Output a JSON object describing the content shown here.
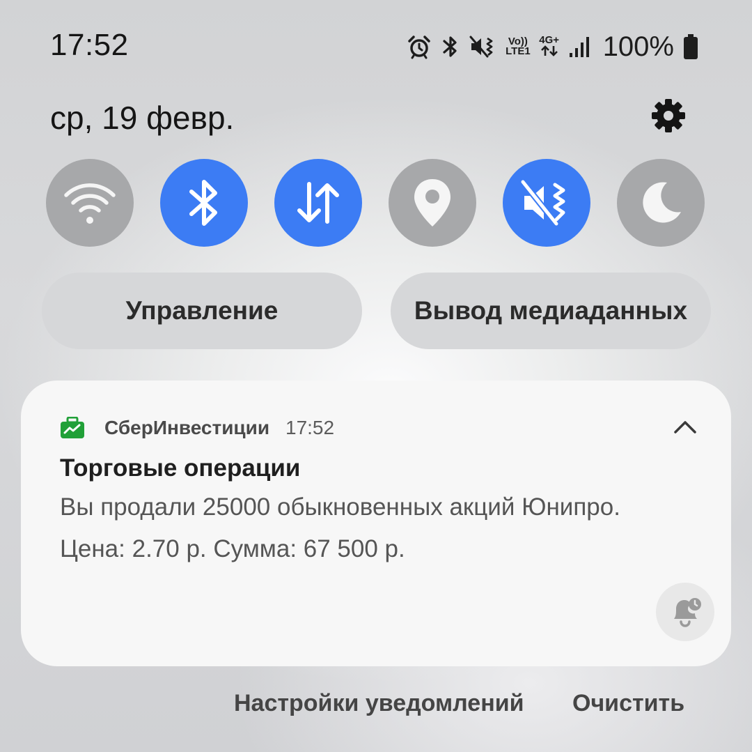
{
  "status_bar": {
    "time": "17:52",
    "icons": [
      "alarm-icon",
      "bluetooth-icon",
      "vibrate-icon",
      "volte-icon",
      "4g-plus-icon",
      "signal-icon",
      "battery-icon"
    ],
    "volte_line1": "Vo))",
    "volte_line2": "LTE1",
    "data_line1": "4G+",
    "battery_text": "100%"
  },
  "header": {
    "date": "ср, 19 февр."
  },
  "quick_settings": {
    "tiles": [
      {
        "name": "wifi",
        "icon": "wifi-icon",
        "active": false
      },
      {
        "name": "bluetooth",
        "icon": "bluetooth-icon",
        "active": true
      },
      {
        "name": "mobile-data",
        "icon": "data-transfer-icon",
        "active": true
      },
      {
        "name": "location",
        "icon": "location-pin-icon",
        "active": false
      },
      {
        "name": "sound",
        "icon": "vibrate-mode-icon",
        "active": true
      },
      {
        "name": "night-mode",
        "icon": "moon-icon",
        "active": false
      }
    ],
    "control_label": "Управление",
    "media_label": "Вывод медиаданных"
  },
  "notification": {
    "app_name": "СберИнвестиции",
    "time": "17:52",
    "title": "Торговые операции",
    "line1": "Вы продали 25000 обыкновенных акций Юнипро.",
    "line2": "Цена: 2.70 р. Сумма: 67 500 р."
  },
  "footer": {
    "settings_label": "Настройки уведомлений",
    "clear_label": "Очистить"
  },
  "colors": {
    "active_tile": "#3c7cf4",
    "inactive_tile": "#a7a8aa",
    "app_icon": "#21a038"
  }
}
